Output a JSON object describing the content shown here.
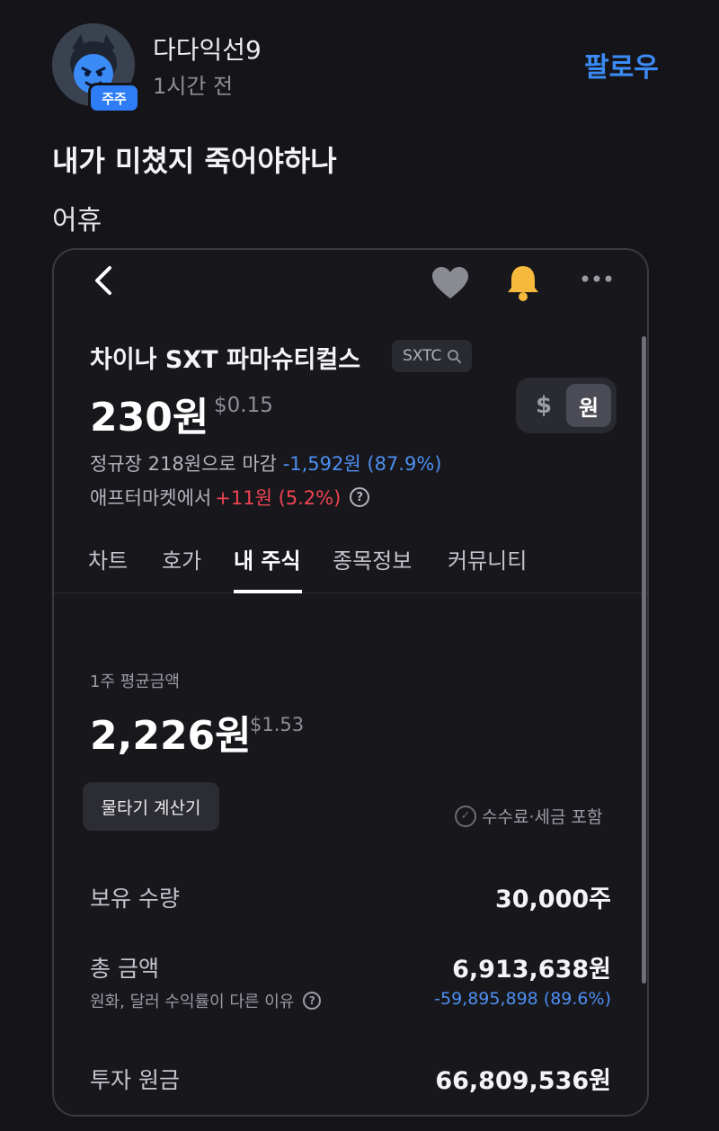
{
  "post": {
    "author": "다다익선9",
    "time_ago": "1시간 전",
    "badge": "주주",
    "follow_label": "팔로우",
    "title": "내가 미쳤지 죽어야하나",
    "body": "어휴"
  },
  "screenshot": {
    "stock": {
      "name": "차이나 SXT 파마슈티컬스",
      "ticker": "SXTC",
      "price": "230원",
      "price_usd": "$0.15",
      "close_text": "정규장 218원으로 마감",
      "close_change": "-1,592원 (87.9%)",
      "after_text": "애프터마켓에서",
      "after_change": "+11원 (5.2%)"
    },
    "currency_toggle": {
      "dollar": "$",
      "won": "원",
      "selected": "원"
    },
    "tabs": [
      {
        "label": "차트"
      },
      {
        "label": "호가"
      },
      {
        "label": "내 주식"
      },
      {
        "label": "종목정보"
      },
      {
        "label": "커뮤니티"
      }
    ],
    "active_tab": "내 주식",
    "holding": {
      "avg_label": "1주 평균금액",
      "avg_price": "2,226원",
      "avg_price_usd": "$1.53",
      "calc_button": "물타기 계산기",
      "fee_note": "수수료·세금 포함",
      "quantity_label": "보유 수량",
      "quantity_value": "30,000주",
      "total_label": "총 금액",
      "total_value": "6,913,638원",
      "fx_note": "원화, 달러 수익률이 다른 이유",
      "total_change": "-59,895,898 (89.6%)",
      "principal_label": "투자 원금",
      "principal_value": "66,809,536원"
    },
    "colors": {
      "up": "#f04452",
      "down": "#4d8ff0",
      "bell": "#f6b93b",
      "heart": "#8a8b92"
    },
    "icons": [
      "back-icon",
      "heart-icon",
      "bell-icon",
      "more-icon",
      "search-icon",
      "help-icon",
      "check-icon"
    ]
  }
}
